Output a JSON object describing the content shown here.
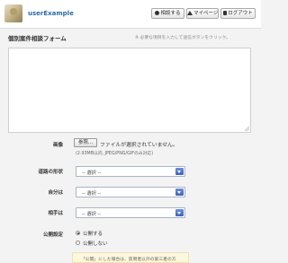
{
  "header": {
    "username": "userExample",
    "buttons": [
      {
        "label": "相談する",
        "icon": "plus-circle-icon"
      },
      {
        "label": "マイページ",
        "icon": "home-icon"
      },
      {
        "label": "ログアウト",
        "icon": "logout-icon"
      }
    ]
  },
  "form": {
    "title": "個別案件相談フォーム",
    "note": "※ 必要な項目を入力して送信ボタンをクリック。",
    "textarea_value": "",
    "image": {
      "label": "画像",
      "file_button": "参照...",
      "file_status": "ファイルが選択されていません。",
      "hint": "(2.93MB以内, JPEG/PNG/GIFのみ対応)"
    },
    "selects": [
      {
        "label": "道路の形状",
        "value": "-- 選択 --"
      },
      {
        "label": "自分は",
        "value": "-- 選択 --"
      },
      {
        "label": "相手は",
        "value": "-- 選択 --"
      }
    ],
    "publish": {
      "label": "公開設定",
      "options": [
        {
          "label": "公開する",
          "checked": true
        },
        {
          "label": "公開しない",
          "checked": false
        }
      ]
    },
    "info_text": "「公開」にした場合は、質問者以外の第三者の方"
  }
}
